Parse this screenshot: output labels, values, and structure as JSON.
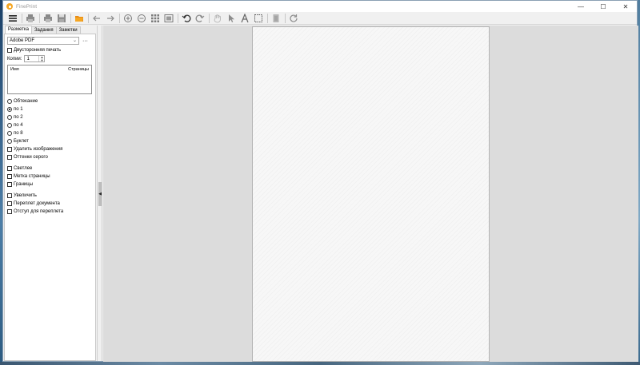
{
  "window": {
    "title": "FinePrint",
    "controls": {
      "minimize": "—",
      "maximize": "☐",
      "close": "✕"
    }
  },
  "toolbar": {
    "buttons": [
      "menu-icon",
      "print-icon",
      "print-all-icon",
      "save-icon",
      "open-folder-icon",
      "back-arrow-icon",
      "forward-arrow-icon",
      "zoom-in-icon",
      "zoom-out-icon",
      "grid-view-icon",
      "fit-page-icon",
      "undo-icon",
      "redo-icon",
      "hand-icon",
      "pointer-icon",
      "text-icon",
      "select-area-icon",
      "delete-page-icon",
      "refresh-icon"
    ]
  },
  "tabs": [
    "Разметка",
    "Задания",
    "Заметки"
  ],
  "printer": {
    "selected": "Adobe PDF",
    "more_label": "···"
  },
  "duplex": {
    "label": "Двусторонняя печать",
    "checked": false
  },
  "copies": {
    "label": "Копии:",
    "value": "1"
  },
  "jobs_table": {
    "columns": [
      "Имя",
      "Страницы"
    ]
  },
  "layout_options": [
    {
      "label": "Обтекание",
      "checked": false
    },
    {
      "label": "по 1",
      "checked": true
    },
    {
      "label": "по 2",
      "checked": false
    },
    {
      "label": "по 4",
      "checked": false
    },
    {
      "label": "по 8",
      "checked": false
    },
    {
      "label": "Буклет",
      "checked": false
    }
  ],
  "checkboxes_a": [
    {
      "label": "Удалить изображения",
      "checked": false
    },
    {
      "label": "Оттенки серого",
      "checked": false
    }
  ],
  "checkboxes_b": [
    {
      "label": "Светлее",
      "checked": false
    },
    {
      "label": "Метка страницы",
      "checked": false
    },
    {
      "label": "Границы",
      "checked": false
    }
  ],
  "checkboxes_c": [
    {
      "label": "Увеличить",
      "checked": false
    },
    {
      "label": "Переплет документа",
      "checked": false
    },
    {
      "label": "Отступ для переплета",
      "checked": false
    }
  ],
  "colors": {
    "accent": "#f5a623",
    "page": "#f7f7f7",
    "preview_bg": "#dcdcdc"
  }
}
